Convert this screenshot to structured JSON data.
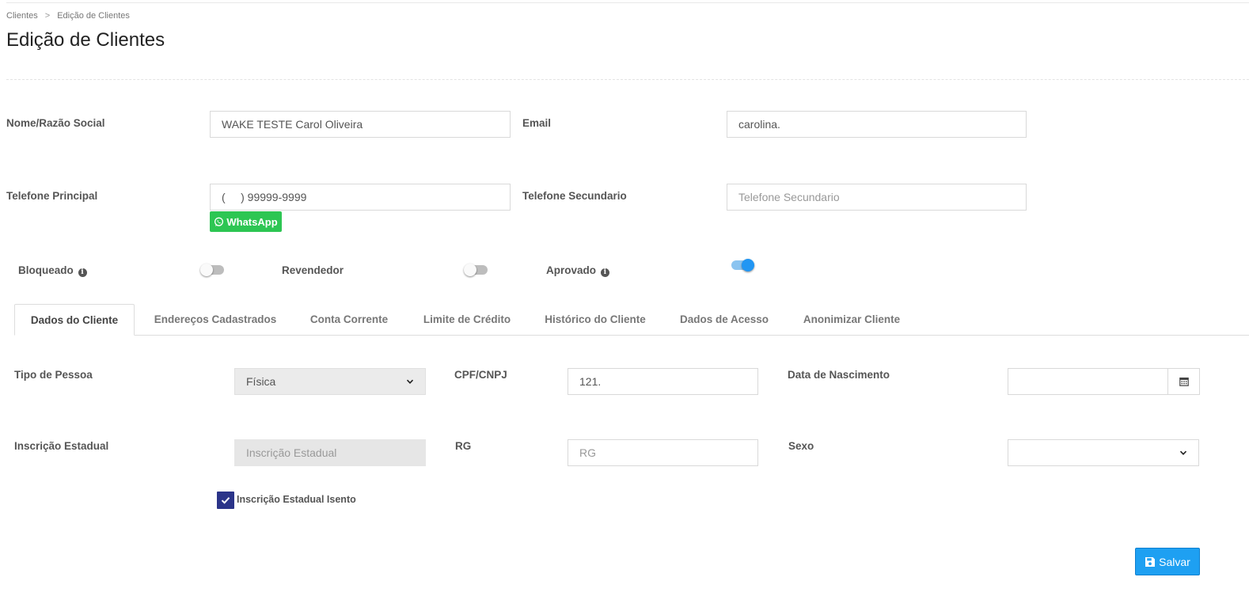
{
  "breadcrumb": {
    "root": "Clientes",
    "separator": ">",
    "current": "Edição de Clientes"
  },
  "page": {
    "title": "Edição de Clientes"
  },
  "form": {
    "nome": {
      "label": "Nome/Razão Social",
      "value": "WAKE TESTE Carol Oliveira"
    },
    "email": {
      "label": "Email",
      "value": "carolina."
    },
    "telefone_principal": {
      "label": "Telefone Principal",
      "value": "(     ) 99999-9999"
    },
    "telefone_secundario": {
      "label": "Telefone Secundario",
      "placeholder": "Telefone Secundario"
    },
    "whatsapp_label": "WhatsApp"
  },
  "toggles": {
    "bloqueado": {
      "label": "Bloqueado",
      "on": false
    },
    "revendedor": {
      "label": "Revendedor",
      "on": false
    },
    "aprovado": {
      "label": "Aprovado",
      "on": true
    }
  },
  "tabs": [
    {
      "label": "Dados do Cliente",
      "active": true
    },
    {
      "label": "Endereços Cadastrados"
    },
    {
      "label": "Conta Corrente"
    },
    {
      "label": "Limite de Crédito"
    },
    {
      "label": "Histórico do Cliente"
    },
    {
      "label": "Dados de Acesso"
    },
    {
      "label": "Anonimizar Cliente"
    }
  ],
  "dados": {
    "tipo_pessoa": {
      "label": "Tipo de Pessoa",
      "value": "Física"
    },
    "cpf_cnpj": {
      "label": "CPF/CNPJ",
      "value": "121."
    },
    "data_nascimento": {
      "label": "Data de Nascimento",
      "value": ""
    },
    "inscricao_estadual": {
      "label": "Inscrição Estadual",
      "placeholder": "Inscrição Estadual"
    },
    "rg": {
      "label": "RG",
      "placeholder": "RG"
    },
    "sexo": {
      "label": "Sexo",
      "value": ""
    },
    "ie_isento": {
      "label": "Inscrição Estadual Isento",
      "checked": true
    }
  },
  "actions": {
    "save_label": "Salvar"
  },
  "colors": {
    "primary": "#1ea0f2",
    "whatsapp": "#2dc653",
    "checkbox": "#2b3489",
    "toggle_on": "#2196f3"
  },
  "icons": {
    "info": "info-circle-icon",
    "calendar": "calendar-icon",
    "save": "save-icon",
    "whatsapp": "whatsapp-icon",
    "chevron": "chevron-down-icon",
    "check": "check-icon"
  }
}
